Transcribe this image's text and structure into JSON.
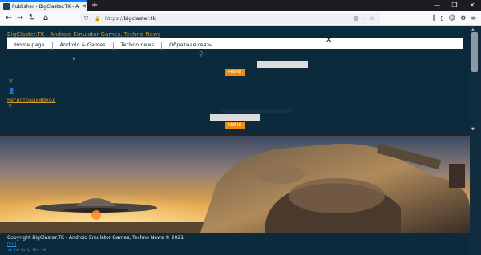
{
  "browser": {
    "tab_title": "Publisher - BigClaster.TK - Andr",
    "new_tab": "+",
    "url_scheme": "https://",
    "url_host": "bigclaster.tk",
    "icons": [
      "back-icon",
      "forward-icon",
      "reload-icon",
      "home-icon",
      "shield-icon",
      "lock-icon",
      "reader-icon",
      "bookmark-star-icon",
      "library-icon",
      "sidebar-icon",
      "account-icon",
      "extensions-icon",
      "menu-icon"
    ],
    "accent": "#0a84ff"
  },
  "site": {
    "title": "BigClaster.TK - Android Emulator Games, Techno News",
    "menu": [
      "Home page",
      "Android & Games",
      "Techno news",
      "Обратная связь"
    ],
    "search_button": "Найти",
    "search_button_2": "Найти",
    "auth": "РегистрацияВход",
    "accent": "#f08a0a"
  },
  "footer": {
    "copyright": "Copyright BigClaster.TK - Android Emulator Games, Techno News © 2021",
    "lang": "[En]",
    "social": [
      "vk",
      "tw",
      "fb",
      "ig",
      "G+",
      "ok"
    ]
  }
}
